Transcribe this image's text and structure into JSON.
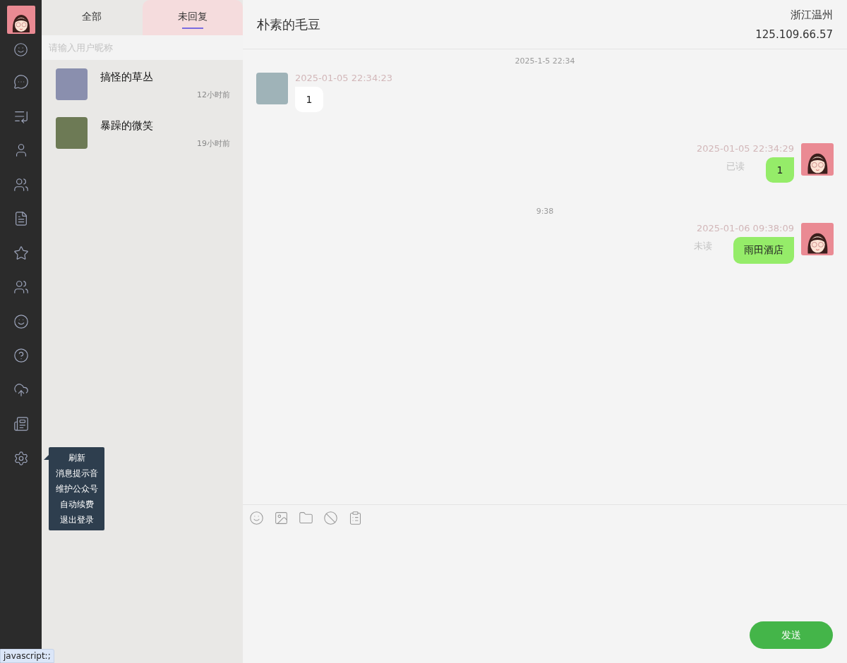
{
  "tabs": [
    {
      "label": "全部",
      "selected": false
    },
    {
      "label": "未回复",
      "selected": true
    }
  ],
  "search": {
    "placeholder": "请输入用户昵称"
  },
  "contacts": [
    {
      "name": "搞怪的草丛",
      "time": "12小时前"
    },
    {
      "name": "暴躁的微笑",
      "time": "19小时前"
    }
  ],
  "settings_menu": [
    "刷新",
    "消息提示音",
    "维护公众号",
    "自动续费",
    "退出登录"
  ],
  "chat": {
    "title": "朴素的毛豆",
    "location": "浙江温州",
    "ip": "125.109.66.57",
    "messages": [
      {
        "kind": "time",
        "text": "2025-1-5 22:34"
      },
      {
        "kind": "received",
        "time": "2025-01-05 22:34:23",
        "text": "1"
      },
      {
        "kind": "sent",
        "time": "2025-01-05 22:34:29",
        "text": "1",
        "status": "已读"
      },
      {
        "kind": "time",
        "text": "9:38"
      },
      {
        "kind": "sent",
        "time": "2025-01-06 09:38:09",
        "text": "雨田酒店",
        "status": "未读"
      }
    ],
    "send_button": "发送"
  },
  "status_bar": "javascript:;"
}
